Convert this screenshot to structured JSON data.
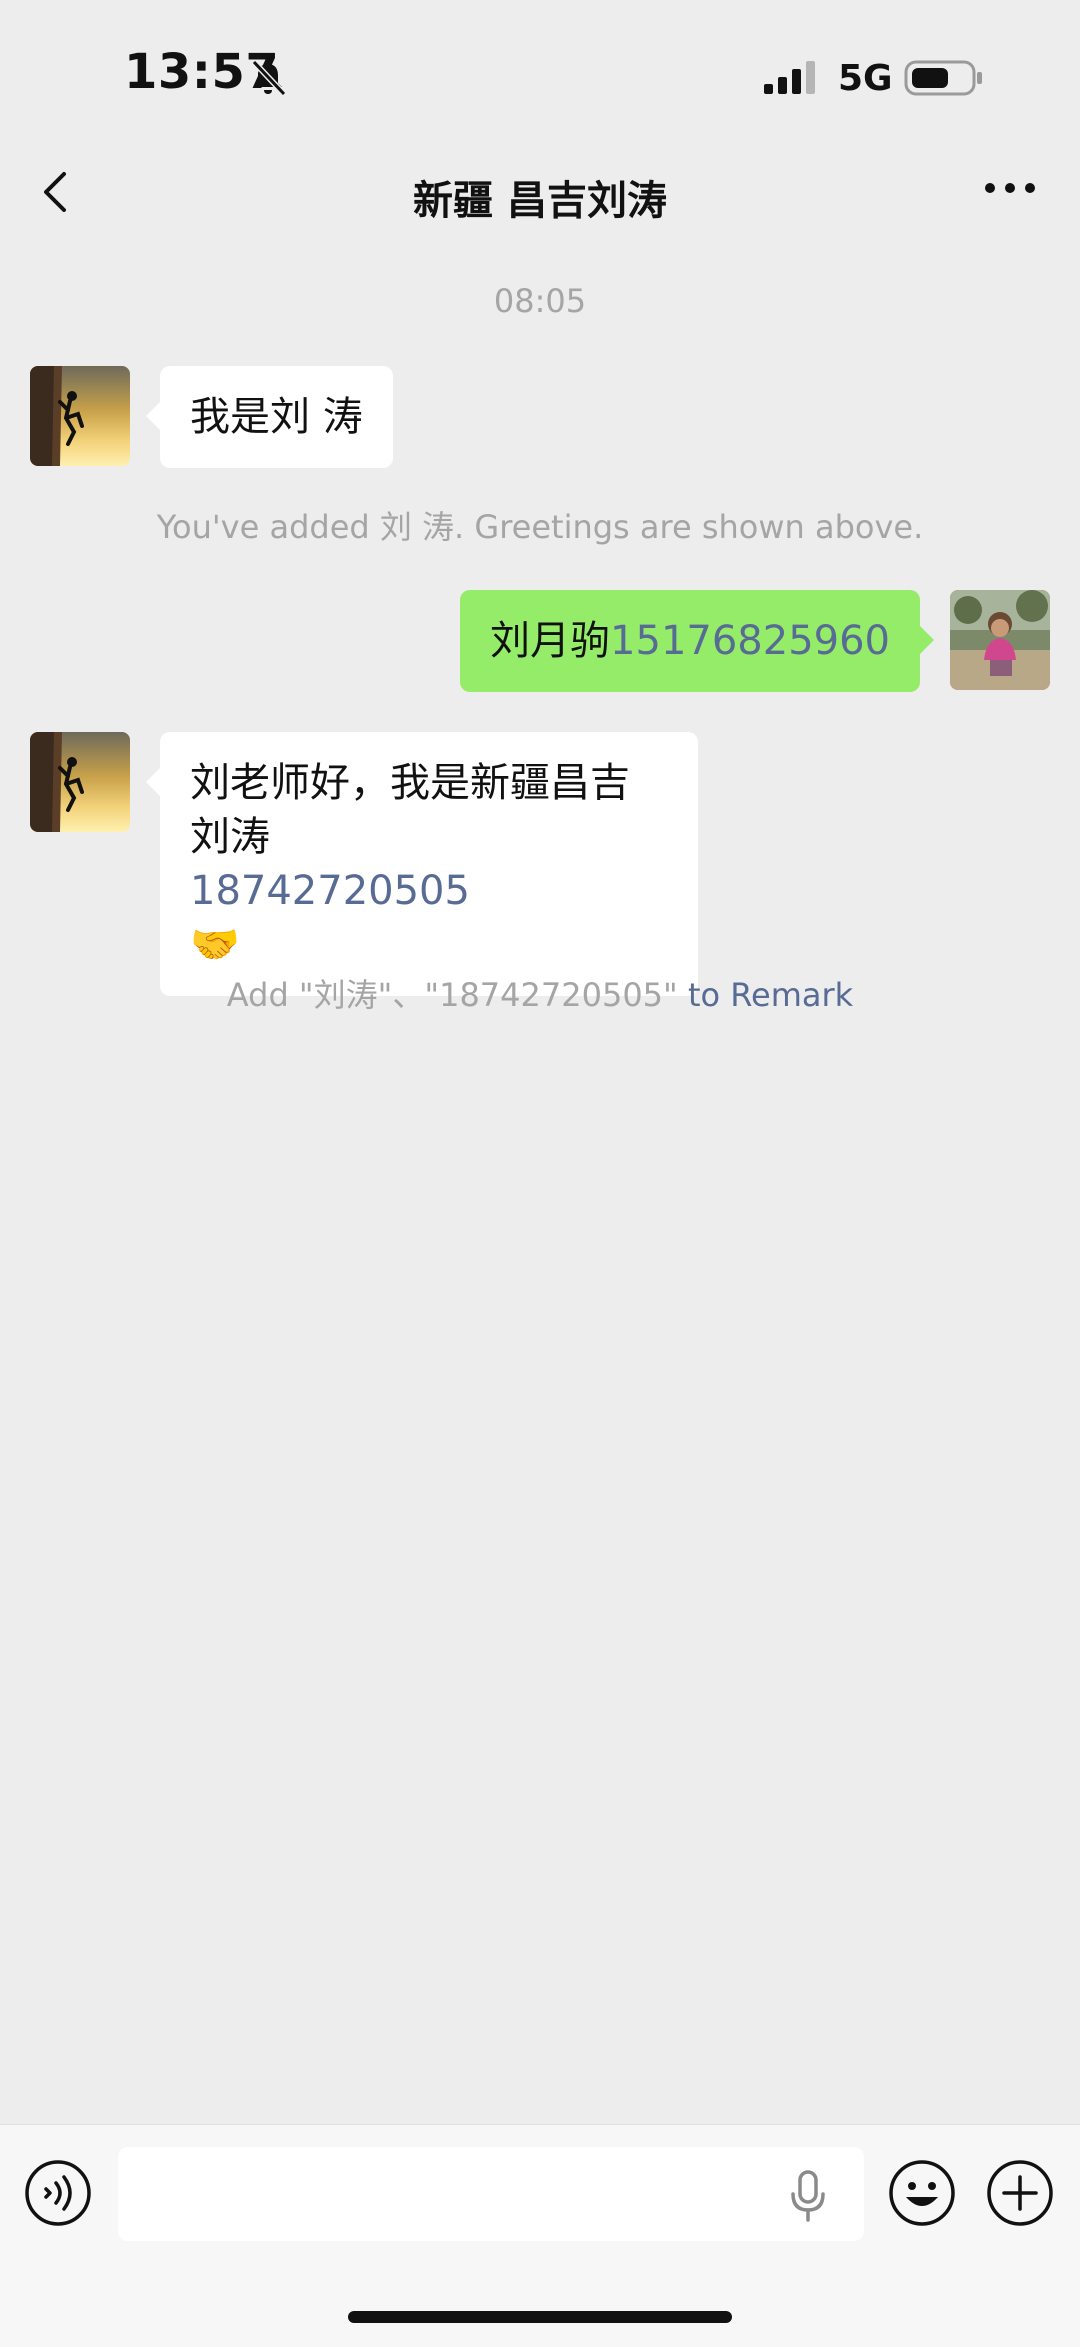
{
  "status_bar": {
    "time": "13:57",
    "network": "5G",
    "icons": [
      "bell-muted-icon",
      "signal-icon",
      "battery-icon"
    ]
  },
  "nav": {
    "title": "新疆 昌吉刘涛",
    "back_icon": "chevron-left-icon",
    "more_icon": "more-dots-icon"
  },
  "chat": {
    "timestamp": "08:05",
    "messages": [
      {
        "direction": "in",
        "text": "我是刘 涛"
      },
      {
        "direction": "out",
        "text": "刘月驹",
        "number": "15176825960"
      },
      {
        "direction": "in",
        "text": "刘老师好，我是新疆昌吉刘涛",
        "number": "18742720505",
        "emoji": "🤝"
      }
    ],
    "system_added": "You've added 刘 涛. Greetings are shown above.",
    "remark_prefix": "Add \"刘涛\"、\"18742720505\"",
    "remark_link": "to Remark"
  },
  "input_bar": {
    "voice_icon": "voice-icon",
    "mic_icon": "microphone-icon",
    "emoji_icon": "emoji-smile-icon",
    "plus_icon": "plus-circle-icon",
    "input_value": "",
    "input_placeholder": ""
  },
  "colors": {
    "background": "#EDEDED",
    "incoming_bubble": "#FFFFFF",
    "outgoing_bubble": "#95EC69",
    "link": "#576B95",
    "system_text": "#A5A5A5"
  }
}
